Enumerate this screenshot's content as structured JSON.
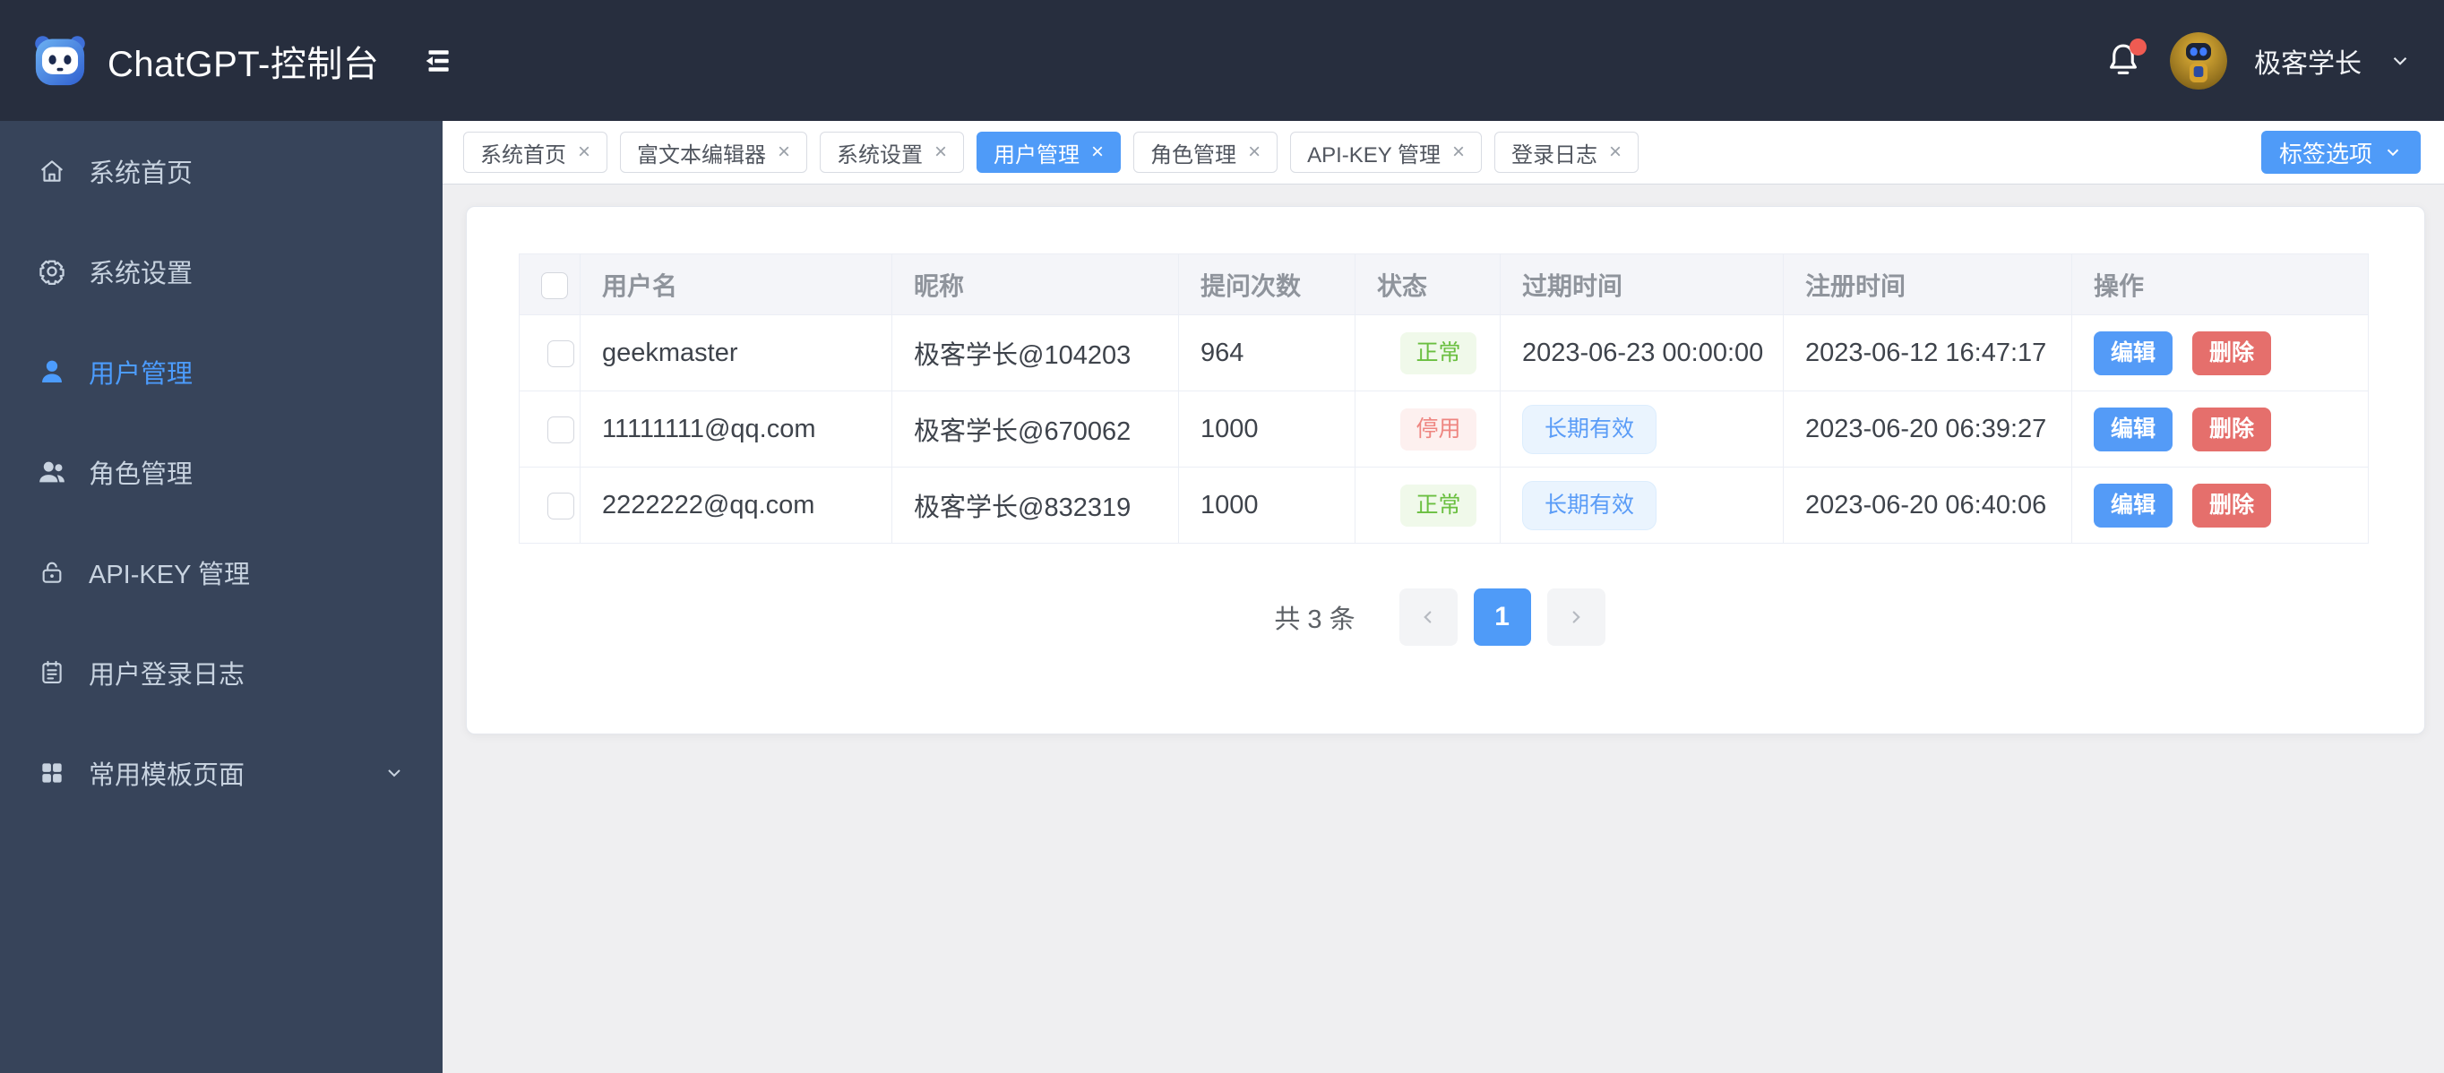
{
  "topbar": {
    "title": "ChatGPT-控制台",
    "username": "极客学长"
  },
  "sidebar": {
    "items": [
      {
        "label": "系统首页",
        "icon": "home-icon",
        "active": false
      },
      {
        "label": "系统设置",
        "icon": "gear-icon",
        "active": false
      },
      {
        "label": "用户管理",
        "icon": "user-icon",
        "active": true
      },
      {
        "label": "角色管理",
        "icon": "users-icon",
        "active": false
      },
      {
        "label": "API-KEY 管理",
        "icon": "lock-icon",
        "active": false
      },
      {
        "label": "用户登录日志",
        "icon": "log-icon",
        "active": false
      },
      {
        "label": "常用模板页面",
        "icon": "grid-icon",
        "active": false,
        "expandable": true
      }
    ]
  },
  "tabbar": {
    "tabs": [
      {
        "label": "系统首页",
        "active": false
      },
      {
        "label": "富文本编辑器",
        "active": false
      },
      {
        "label": "系统设置",
        "active": false
      },
      {
        "label": "用户管理",
        "active": true
      },
      {
        "label": "角色管理",
        "active": false
      },
      {
        "label": "API-KEY 管理",
        "active": false
      },
      {
        "label": "登录日志",
        "active": false
      }
    ],
    "options_label": "标签选项"
  },
  "table": {
    "headers": [
      "用户名",
      "昵称",
      "提问次数",
      "状态",
      "过期时间",
      "注册时间",
      "操作"
    ],
    "rows": [
      {
        "username": "geekmaster",
        "nickname": "极客学长@104203",
        "count": "964",
        "status": "正常",
        "expiry": "2023-06-23 00:00:00",
        "registered": "2023-06-12 16:47:17"
      },
      {
        "username": "11111111@qq.com",
        "nickname": "极客学长@670062",
        "count": "1000",
        "status": "停用",
        "expiry": "长期有效",
        "registered": "2023-06-20 06:39:27"
      },
      {
        "username": "2222222@qq.com",
        "nickname": "极客学长@832319",
        "count": "1000",
        "status": "正常",
        "expiry": "长期有效",
        "registered": "2023-06-20 06:40:06"
      }
    ]
  },
  "actions": {
    "edit": "编辑",
    "delete": "删除"
  },
  "pagination": {
    "total": "共 3 条",
    "page": "1"
  },
  "glyphs": {
    "close": "×"
  },
  "colors": {
    "accent_blue": "#4f9bf8",
    "success_green": "#6abf40",
    "success_bg": "#f0f9ea",
    "danger_red": "#e56f6c",
    "danger_badge_text": "#ee8580",
    "danger_badge_bg": "#fdf0ef",
    "long_badge_text": "#5a9cf7",
    "long_badge_bg": "#eaf4fe",
    "topbar_bg": "#272e3e",
    "sidebar_bg": "#37445a",
    "page_bg": "#efeff1",
    "notification_dot": "#ef5b52"
  }
}
